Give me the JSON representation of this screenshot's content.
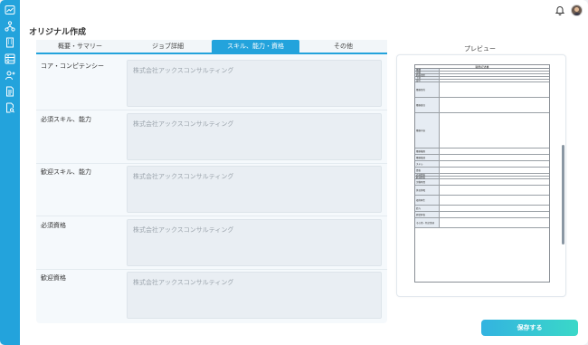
{
  "header": {
    "title": "オリジナル作成"
  },
  "tabs": [
    {
      "label": "概要・サマリー",
      "active": false
    },
    {
      "label": "ジョブ詳細",
      "active": false
    },
    {
      "label": "スキル、能力・資格",
      "active": true
    },
    {
      "label": "その他",
      "active": false
    }
  ],
  "fields": [
    {
      "label": "コア・コンピテンシー",
      "placeholder": "株式会社アックスコンサルティング"
    },
    {
      "label": "必須スキル、能力",
      "placeholder": "株式会社アックスコンサルティング"
    },
    {
      "label": "歓迎スキル、能力",
      "placeholder": "株式会社アックスコンサルティング"
    },
    {
      "label": "必須資格",
      "placeholder": "株式会社アックスコンサルティング"
    },
    {
      "label": "歓迎資格",
      "placeholder": "株式会社アックスコンサルティング"
    }
  ],
  "preview": {
    "title": "プレビュー",
    "doc_title": "職務記述書",
    "doc_rows": [
      "職種",
      "部署",
      "勤務場所",
      "上司",
      "部下",
      "職務目的",
      "職務責任",
      "職務内容",
      "職務権限",
      "職務範囲",
      "スキル",
      "資格",
      "必須資格",
      "歓迎資格",
      "労働時間",
      "休日休暇",
      "福利厚生",
      "給与",
      "昇給昇格",
      "その他・特記事項"
    ]
  },
  "actions": {
    "save_label": "保存する"
  },
  "sidebar": {
    "icons": [
      "dashboard-icon",
      "org-chart-icon",
      "building-icon",
      "list-icon",
      "add-user-icon",
      "document-icon",
      "document-search-icon"
    ]
  },
  "colors": {
    "accent": "#23a3dc",
    "save_gradient_start": "#33b3e0",
    "save_gradient_end": "#3ad8c8"
  }
}
